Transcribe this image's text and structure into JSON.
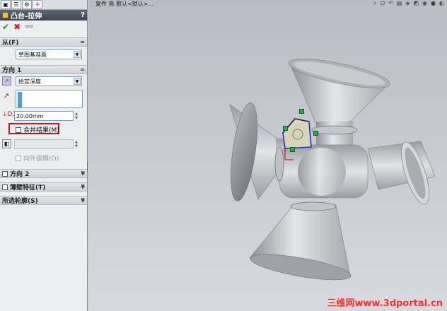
{
  "viewport": {
    "toolbar_text": "复件 亮  默认<默认>...",
    "watermark": "三维网www.3dportal.cn"
  },
  "property_manager": {
    "tab_icons": [
      "feature-manager-icon",
      "property-manager-icon",
      "configuration-manager-icon",
      "dimxpert-icon"
    ],
    "title": "凸台-拉伸",
    "help": "?",
    "from_section": {
      "label": "从(F)",
      "start_value": "草图基准面"
    },
    "direction1": {
      "label": "方向 1",
      "end_condition": "给定深度",
      "depth": "20.00mm",
      "merge_result_label": "合并结果(M)",
      "draft_outward_label": "向外拔模(O)"
    },
    "direction2": {
      "label": "方向 2"
    },
    "thin_feature": {
      "label": "薄壁特征(T)"
    },
    "selected_contours": {
      "label": "所选轮廓(S)"
    }
  }
}
